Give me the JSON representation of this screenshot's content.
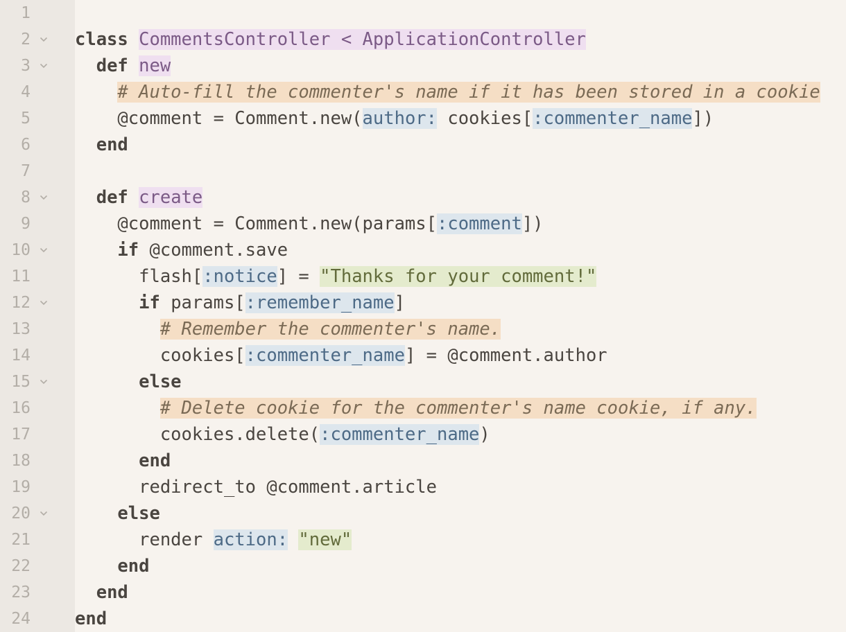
{
  "colors": {
    "background": "#f7f3ee",
    "gutter": "#ece8e3",
    "line_number": "#b3aea7",
    "keyword": "#4a4540",
    "class_highlight": "#efdff0",
    "comment_highlight": "#f5dec5",
    "symbol_highlight": "#dde6ed",
    "string_highlight": "#e4ebcd"
  },
  "lines": [
    {
      "number": "1",
      "fold": false,
      "indent": 0,
      "tokens": []
    },
    {
      "number": "2",
      "fold": true,
      "indent": 0,
      "tokens": [
        {
          "t": "kw",
          "v": "class"
        },
        {
          "t": "plain",
          "v": " "
        },
        {
          "t": "cls",
          "v": "CommentsController < ApplicationController"
        }
      ]
    },
    {
      "number": "3",
      "fold": true,
      "indent": 1,
      "tokens": [
        {
          "t": "kw",
          "v": "def"
        },
        {
          "t": "plain",
          "v": " "
        },
        {
          "t": "def",
          "v": "new"
        }
      ]
    },
    {
      "number": "4",
      "fold": false,
      "indent": 2,
      "tokens": [
        {
          "t": "cmt",
          "v": "# Auto-fill the commenter's name if it has been stored in a cookie"
        }
      ]
    },
    {
      "number": "5",
      "fold": false,
      "indent": 2,
      "tokens": [
        {
          "t": "plain",
          "v": "@comment = Comment.new("
        },
        {
          "t": "sym",
          "v": "author:"
        },
        {
          "t": "plain",
          "v": " cookies["
        },
        {
          "t": "sym",
          "v": ":commenter_name"
        },
        {
          "t": "plain",
          "v": "])"
        }
      ]
    },
    {
      "number": "6",
      "fold": false,
      "indent": 1,
      "tokens": [
        {
          "t": "kw",
          "v": "end"
        }
      ]
    },
    {
      "number": "7",
      "fold": false,
      "indent": 0,
      "tokens": []
    },
    {
      "number": "8",
      "fold": true,
      "indent": 1,
      "tokens": [
        {
          "t": "kw",
          "v": "def"
        },
        {
          "t": "plain",
          "v": " "
        },
        {
          "t": "def",
          "v": "create"
        }
      ]
    },
    {
      "number": "9",
      "fold": false,
      "indent": 2,
      "tokens": [
        {
          "t": "plain",
          "v": "@comment = Comment.new(params["
        },
        {
          "t": "sym",
          "v": ":comment"
        },
        {
          "t": "plain",
          "v": "])"
        }
      ]
    },
    {
      "number": "10",
      "fold": true,
      "indent": 2,
      "tokens": [
        {
          "t": "kw",
          "v": "if"
        },
        {
          "t": "plain",
          "v": " @comment.save"
        }
      ]
    },
    {
      "number": "11",
      "fold": false,
      "indent": 3,
      "tokens": [
        {
          "t": "plain",
          "v": "flash["
        },
        {
          "t": "sym",
          "v": ":notice"
        },
        {
          "t": "plain",
          "v": "] = "
        },
        {
          "t": "str",
          "v": "\"Thanks for your comment!\""
        }
      ]
    },
    {
      "number": "12",
      "fold": true,
      "indent": 3,
      "tokens": [
        {
          "t": "kw",
          "v": "if"
        },
        {
          "t": "plain",
          "v": " params["
        },
        {
          "t": "sym",
          "v": ":remember_name"
        },
        {
          "t": "plain",
          "v": "]"
        }
      ]
    },
    {
      "number": "13",
      "fold": false,
      "indent": 4,
      "tokens": [
        {
          "t": "cmt",
          "v": "# Remember the commenter's name."
        }
      ]
    },
    {
      "number": "14",
      "fold": false,
      "indent": 4,
      "tokens": [
        {
          "t": "plain",
          "v": "cookies["
        },
        {
          "t": "sym",
          "v": ":commenter_name"
        },
        {
          "t": "plain",
          "v": "] = @comment.author"
        }
      ]
    },
    {
      "number": "15",
      "fold": true,
      "indent": 3,
      "tokens": [
        {
          "t": "kw",
          "v": "else"
        }
      ]
    },
    {
      "number": "16",
      "fold": false,
      "indent": 4,
      "tokens": [
        {
          "t": "cmt",
          "v": "# Delete cookie for the commenter's name cookie, if any."
        }
      ]
    },
    {
      "number": "17",
      "fold": false,
      "indent": 4,
      "tokens": [
        {
          "t": "plain",
          "v": "cookies.delete("
        },
        {
          "t": "sym",
          "v": ":commenter_name"
        },
        {
          "t": "plain",
          "v": ")"
        }
      ]
    },
    {
      "number": "18",
      "fold": false,
      "indent": 3,
      "tokens": [
        {
          "t": "kw",
          "v": "end"
        }
      ]
    },
    {
      "number": "19",
      "fold": false,
      "indent": 3,
      "tokens": [
        {
          "t": "plain",
          "v": "redirect_to @comment.article"
        }
      ]
    },
    {
      "number": "20",
      "fold": true,
      "indent": 2,
      "tokens": [
        {
          "t": "kw",
          "v": "else"
        }
      ]
    },
    {
      "number": "21",
      "fold": false,
      "indent": 3,
      "tokens": [
        {
          "t": "plain",
          "v": "render "
        },
        {
          "t": "sym",
          "v": "action:"
        },
        {
          "t": "plain",
          "v": " "
        },
        {
          "t": "str",
          "v": "\"new\""
        }
      ]
    },
    {
      "number": "22",
      "fold": false,
      "indent": 2,
      "tokens": [
        {
          "t": "kw",
          "v": "end"
        }
      ]
    },
    {
      "number": "23",
      "fold": false,
      "indent": 1,
      "tokens": [
        {
          "t": "kw",
          "v": "end"
        }
      ]
    },
    {
      "number": "24",
      "fold": false,
      "indent": 0,
      "tokens": [
        {
          "t": "kw",
          "v": "end"
        }
      ]
    }
  ]
}
